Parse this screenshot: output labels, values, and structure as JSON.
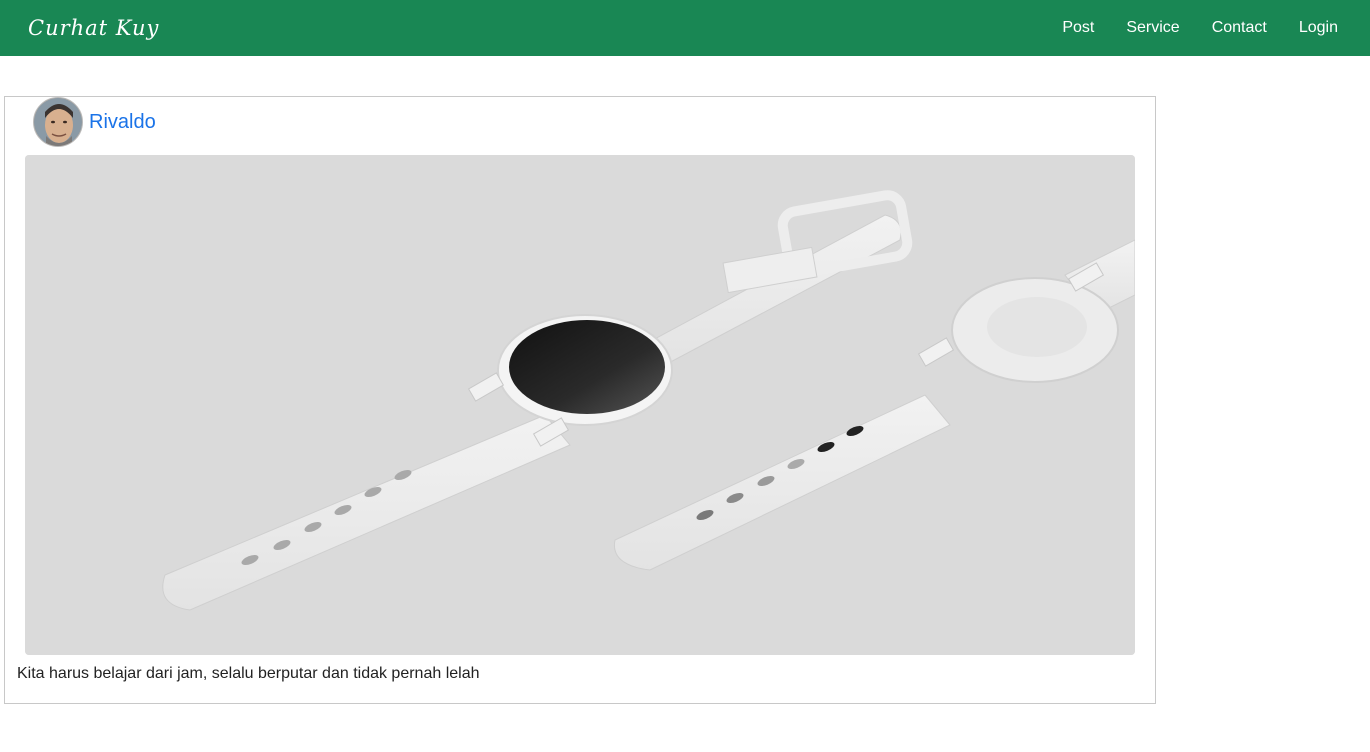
{
  "navbar": {
    "brand": "Curhat Kuy",
    "links": [
      "Post",
      "Service",
      "Contact",
      "Login"
    ],
    "bg_color": "#198754"
  },
  "post": {
    "author": "Rivaldo",
    "author_color": "#1a73e8",
    "image_subject": "watch-image",
    "caption": "Kita harus belajar dari jam, selalu berputar dan tidak pernah lelah"
  }
}
